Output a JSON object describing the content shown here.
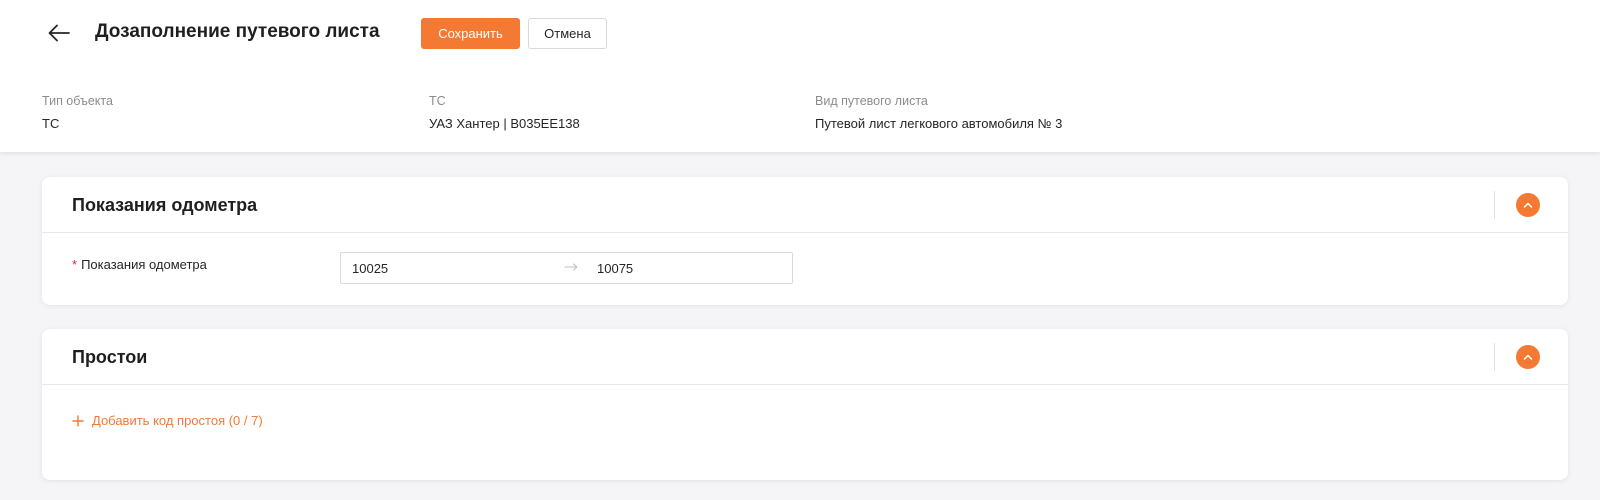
{
  "header": {
    "title": "Дозаполнение путевого листа",
    "save_label": "Сохранить",
    "cancel_label": "Отмена",
    "back_icon": "arrow-left-icon"
  },
  "info": [
    {
      "label": "Тип объекта",
      "value": "ТС"
    },
    {
      "label": "ТС",
      "value": "УАЗ Хантер | В035ЕЕ138"
    },
    {
      "label": "Вид путевого листа",
      "value": "Путевой лист легкового автомобиля № 3"
    }
  ],
  "odometer_section": {
    "title": "Показания одометра",
    "field_required_mark": "*",
    "field_label": "Показания одометра",
    "start_value": "10025",
    "end_value": "10075",
    "collapse_icon": "chevron-up-icon"
  },
  "downtime_section": {
    "title": "Простои",
    "add_label": "Добавить код простоя (0 / 7)",
    "add_icon": "plus-icon",
    "collapse_icon": "chevron-up-icon"
  },
  "colors": {
    "accent": "#f47a34",
    "background": "#f5f5f7",
    "required": "#f5222d"
  }
}
